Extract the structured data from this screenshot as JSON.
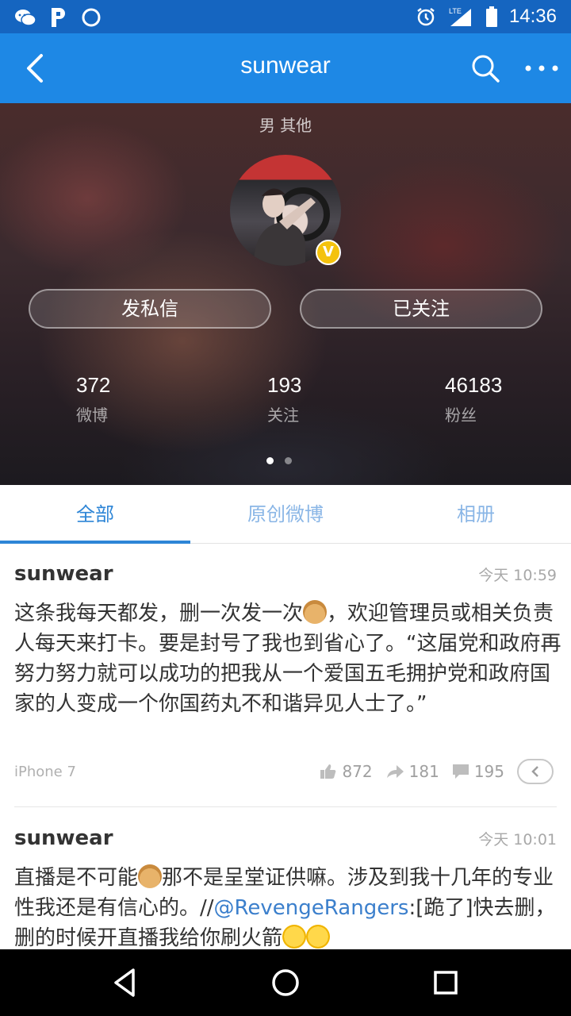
{
  "status_bar": {
    "time": "14:36",
    "left_icons": [
      "wechat-icon",
      "pay-icon",
      "circle-icon"
    ],
    "right_icons": [
      "alarm-icon",
      "lte-signal-icon",
      "battery-icon"
    ],
    "network": "LTE"
  },
  "title_bar": {
    "title": "sunwear",
    "icons": [
      "back-icon",
      "search-icon",
      "more-icon"
    ]
  },
  "profile": {
    "gender_region": "男 其他",
    "verified_badge": "V",
    "buttons": {
      "message": "发私信",
      "follow": "已关注"
    },
    "stats": [
      {
        "count": "372",
        "label": "微博"
      },
      {
        "count": "193",
        "label": "关注"
      },
      {
        "count": "46183",
        "label": "粉丝"
      }
    ],
    "page_dots": {
      "count": 2,
      "active": 0
    }
  },
  "tabs": [
    {
      "label": "全部",
      "active": true
    },
    {
      "label": "原创微博",
      "active": false
    },
    {
      "label": "相册",
      "active": false
    }
  ],
  "posts": [
    {
      "author": "sunwear",
      "time": "今天 10:59",
      "text_part1": "这条我每天都发，删一次发一次",
      "text_part2": "，欢迎管理员或相关负责人每天来打卡。要是封号了我也到省心了。“这届党和政府再努力努力就可以成功的把我从一个爱国五毛拥护党和政府国家的人变成一个你国药丸不和谐异见人士了。”",
      "source": "iPhone 7",
      "likes": "872",
      "reposts": "181",
      "comments": "195"
    },
    {
      "author": "sunwear",
      "time": "今天 10:01",
      "text_part1": "直播是不可能",
      "text_part2": "那不是呈堂证供嘛。涉及到我十几年的专业性我还是有信心的。//",
      "mention": "@RevengeRangers",
      "text_part3": ":[跪了]快去删，删的时候开直播我给你刷火箭"
    }
  ],
  "colors": {
    "status_bar": "#1565c0",
    "title_bar": "#1e88e5",
    "tab_active": "#2d85d6",
    "tab_inactive": "#8ab6e6",
    "mention": "#3b7fcc"
  }
}
